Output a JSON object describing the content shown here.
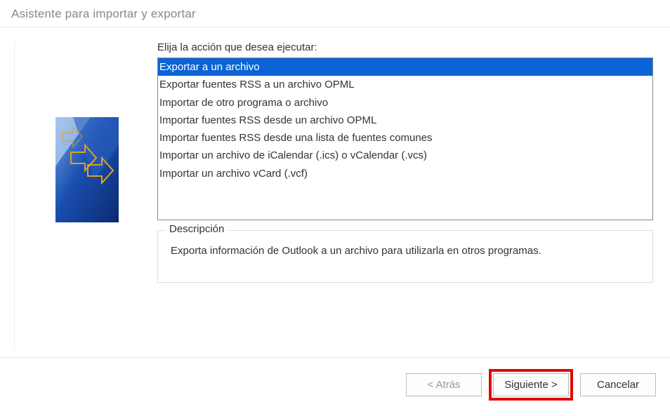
{
  "title": "Asistente para importar y exportar",
  "prompt": "Elija la acción que desea ejecutar:",
  "actions": [
    "Exportar a un archivo",
    "Exportar fuentes RSS a un archivo OPML",
    "Importar de otro programa o archivo",
    "Importar fuentes RSS desde un archivo OPML",
    "Importar fuentes RSS desde una lista de fuentes comunes",
    "Importar un archivo de iCalendar (.ics) o vCalendar (.vcs)",
    "Importar un archivo vCard (.vcf)"
  ],
  "selected_index": 0,
  "description_label": "Descripción",
  "description_text": "Exporta información de Outlook a un archivo para utilizarla en otros programas.",
  "buttons": {
    "back": "< Atrás",
    "next": "Siguiente >",
    "cancel": "Cancelar"
  }
}
